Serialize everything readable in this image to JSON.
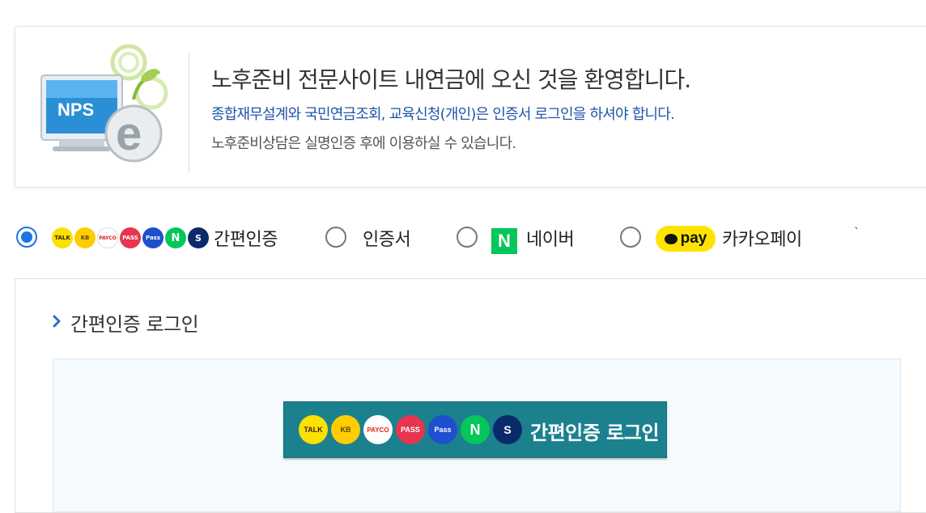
{
  "banner": {
    "logo_text": "NPS",
    "welcome": "노후준비 전문사이트 내연금에 오신 것을 환영합니다.",
    "notice": "종합재무설계와 국민연금조회, 교육신청(개인)은 인증서 로그인을 하셔야 합니다.",
    "sub": "노후준비상담은 실명인증 후에 이용하실 수 있습니다."
  },
  "login_options": [
    {
      "label": "간편인증",
      "selected": true
    },
    {
      "label": "인증서",
      "selected": false
    },
    {
      "label": "네이버",
      "selected": false
    },
    {
      "label": "카카오페이",
      "selected": false
    }
  ],
  "icons": {
    "talk": "TALK",
    "kb": "KB",
    "payco": "PAYCO",
    "pass": "PASS",
    "samsung_pass": "Pass",
    "naver": "N",
    "shinhan": "S",
    "kakaopay": "pay"
  },
  "stray_mark": "`",
  "section": {
    "title": "간편인증 로그인",
    "button_label": "간편인증 로그인"
  },
  "colors": {
    "accent_blue": "#1a73e8",
    "notice_blue": "#1f55a8",
    "button_teal": "#1b818e",
    "naver_green": "#03c75a",
    "kakao_yellow": "#ffe300",
    "inner_bg": "#f4fafd"
  }
}
